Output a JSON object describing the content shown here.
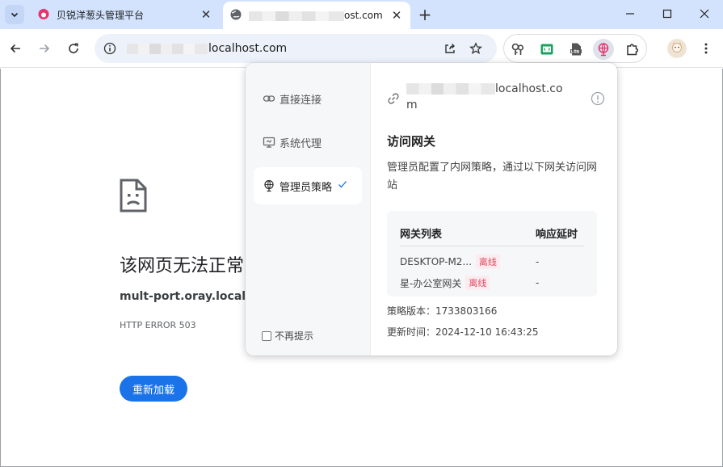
{
  "browser": {
    "tabs": [
      {
        "title": "贝锐洋葱头管理平台"
      },
      {
        "title_suffix": "ost.com"
      }
    ],
    "new_tab_label": "+",
    "omnibox": {
      "url_suffix": "localhost.com"
    }
  },
  "error_page": {
    "title": "该网页无法正常",
    "host": "mult-port.oray.localho",
    "code": "HTTP ERROR 503",
    "reload_label": "重新加载"
  },
  "popup": {
    "modes": [
      {
        "label": "直接连接",
        "icon": "link-icon"
      },
      {
        "label": "系统代理",
        "icon": "monitor-icon"
      },
      {
        "label": "管理员策略",
        "icon": "globe-pin-icon",
        "selected": true
      }
    ],
    "dont_show_label": "不再提示",
    "host_suffix_line1": "localhost.co",
    "host_suffix_line2": "m",
    "gateway_title": "访问网关",
    "gateway_desc": "管理员配置了内网策略，通过以下网关访问网站",
    "table": {
      "col_name": "网关列表",
      "col_latency": "响应延时",
      "rows": [
        {
          "name": "DESKTOP-M2...",
          "status": "离线",
          "latency": "-"
        },
        {
          "name": "星-办公室网关",
          "status": "离线",
          "latency": "-"
        }
      ]
    },
    "policy_version_label": "策略版本：",
    "policy_version": "1733803166",
    "updated_label": "更新时间：",
    "updated_time": "2024-12-10 16:43:25"
  },
  "colors": {
    "accent": "#1a73e8",
    "tabstrip": "#d3e3fd",
    "offline_badge_bg": "#fdecef",
    "offline_badge_text": "#e0475f",
    "favicon": "#e8336d"
  }
}
